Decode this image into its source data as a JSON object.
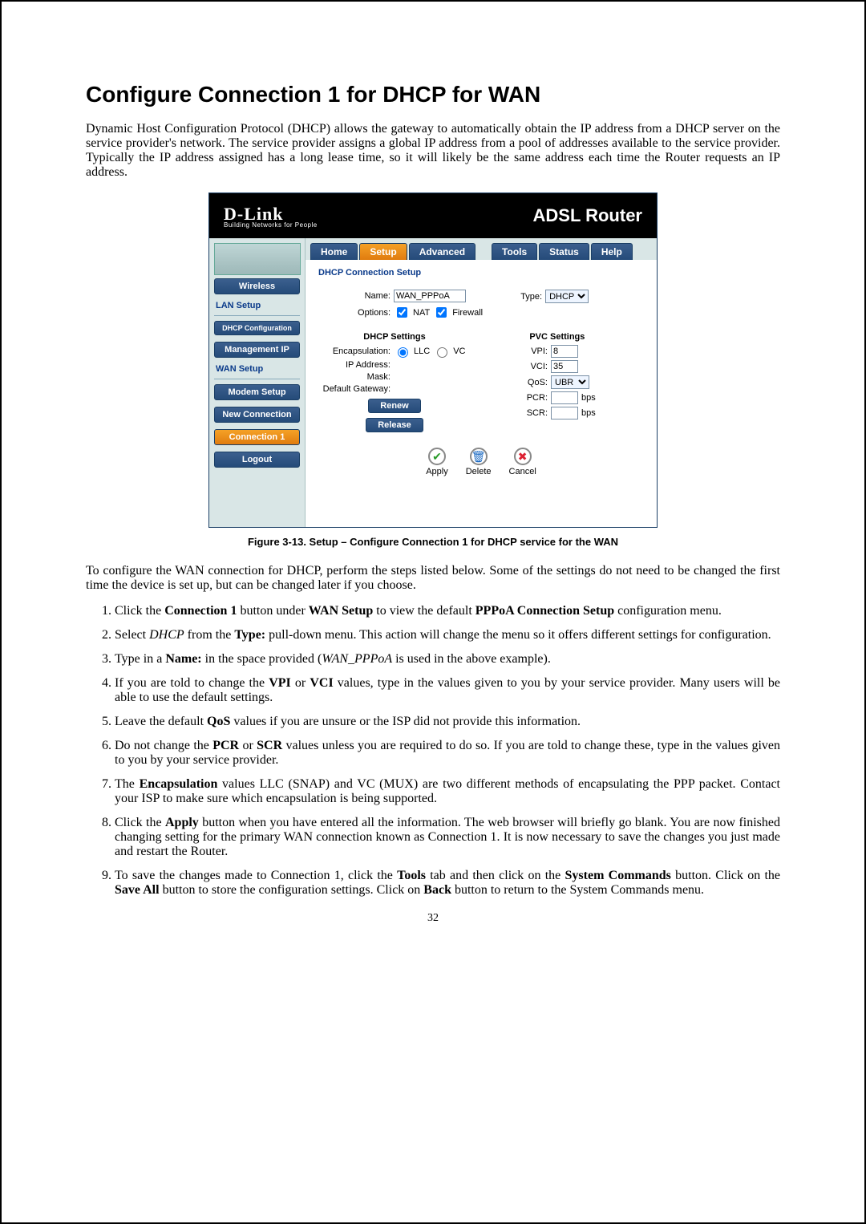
{
  "page": {
    "title": "Configure Connection 1 for DHCP for WAN",
    "intro": "Dynamic Host Configuration Protocol (DHCP) allows the gateway to automatically obtain the IP address from a DHCP server on the service provider's network. The service provider assigns a global IP address from a pool of addresses available to the service provider. Typically the IP address assigned has a long lease time, so it will likely be the same address each time the Router requests an IP address.",
    "figure_caption": "Figure 3-13. Setup – Configure Connection 1 for DHCP service for the WAN",
    "after_text": "To configure the WAN connection for DHCP, perform the steps listed below. Some of the settings do not need to be changed the first time the device is set up, but can be changed later if you choose.",
    "page_number": "32"
  },
  "router": {
    "brand": "D-Link",
    "brand_sub": "Building Networks for People",
    "header_title": "ADSL Router",
    "tabs": {
      "home": "Home",
      "setup": "Setup",
      "advanced": "Advanced",
      "tools": "Tools",
      "status": "Status",
      "help": "Help"
    },
    "panel_title": "DHCP Connection Setup",
    "form": {
      "name_label": "Name:",
      "name_value": "WAN_PPPoA",
      "type_label": "Type:",
      "type_value": "DHCP",
      "options_label": "Options:",
      "nat_label": "NAT",
      "firewall_label": "Firewall",
      "dhcp_heading": "DHCP Settings",
      "encaps_label": "Encapsulation:",
      "llc_label": "LLC",
      "vc_label": "VC",
      "ip_label": "IP Address:",
      "mask_label": "Mask:",
      "gw_label": "Default Gateway:",
      "renew": "Renew",
      "release": "Release",
      "pvc_heading": "PVC Settings",
      "vpi_label": "VPI:",
      "vpi_value": "8",
      "vci_label": "VCI:",
      "vci_value": "35",
      "qos_label": "QoS:",
      "qos_value": "UBR",
      "pcr_label": "PCR:",
      "pcr_unit": "bps",
      "scr_label": "SCR:",
      "scr_unit": "bps"
    },
    "actions": {
      "apply": "Apply",
      "delete": "Delete",
      "cancel": "Cancel"
    },
    "sidebar": {
      "wireless_btn": "Wireless",
      "lan_heading": "LAN Setup",
      "dhcp_config_btn": "DHCP Configuration",
      "mgmt_btn": "Management IP",
      "wan_heading": "WAN Setup",
      "modem_btn": "Modem Setup",
      "newconn_btn": "New Connection",
      "conn1_btn": "Connection 1",
      "logout_btn": "Logout"
    }
  },
  "steps": {
    "s1a": "Click the ",
    "s1b": "Connection 1",
    "s1c": " button under ",
    "s1d": "WAN Setup",
    "s1e": " to view the default ",
    "s1f": "PPPoA Connection Setup",
    "s1g": " configuration menu.",
    "s2a": "Select ",
    "s2b": "DHCP",
    "s2c": " from the ",
    "s2d": "Type:",
    "s2e": " pull-down menu. This action will change the menu so it offers different settings for configuration.",
    "s3a": "Type in a ",
    "s3b": "Name:",
    "s3c": " in the space provided (",
    "s3d": "WAN_PPPoA",
    "s3e": "  is used in the above example).",
    "s4a": "If you are told to change the ",
    "s4b": "VPI",
    "s4c": " or ",
    "s4d": "VCI",
    "s4e": " values, type in the values given to you by your service provider. Many users will be able to use the default settings.",
    "s5a": "Leave the default ",
    "s5b": "QoS",
    "s5c": " values if you are unsure or the ISP did not provide this information.",
    "s6a": "Do not change the ",
    "s6b": "PCR",
    "s6c": " or ",
    "s6d": "SCR",
    "s6e": " values unless you are required to do so. If you are told to change these, type in the values given to you by your service provider.",
    "s7a": "The ",
    "s7b": "Encapsulation",
    "s7c": " values LLC (SNAP) and VC (MUX) are two different methods of encapsulating the PPP packet. Contact your ISP to make sure which encapsulation is being supported.",
    "s8a": "Click the ",
    "s8b": "Apply",
    "s8c": " button when you have entered all the information. The web browser will briefly go blank. You are now finished changing setting for the primary WAN connection known as Connection 1. It is now necessary to save the changes you just made and restart the Router.",
    "s9a": "To save the changes made to Connection 1, click the ",
    "s9b": "Tools",
    "s9c": " tab and then click on the ",
    "s9d": "System Commands",
    "s9e": " button. Click on the ",
    "s9f": "Save All",
    "s9g": " button to store the configuration settings. Click on ",
    "s9h": "Back",
    "s9i": " button to return to the System Commands menu."
  }
}
